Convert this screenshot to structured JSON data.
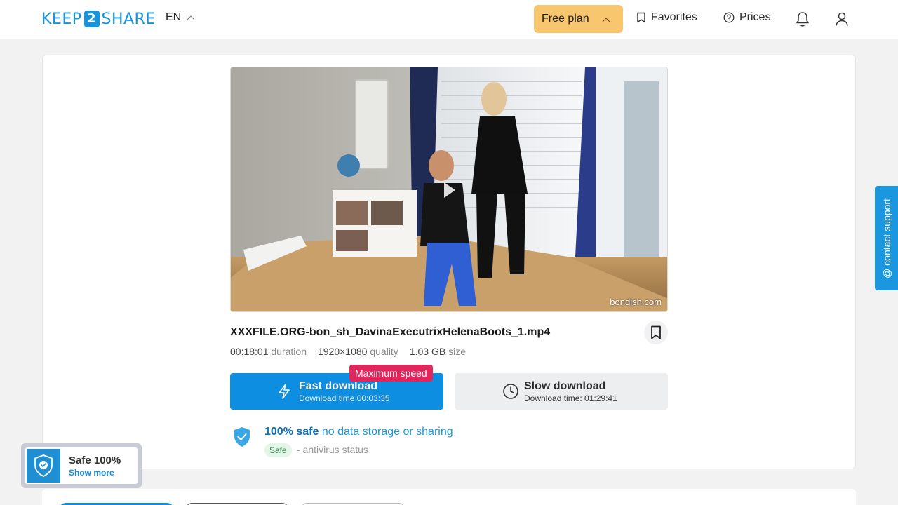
{
  "header": {
    "logo_pre": "KEEP",
    "logo_num": "2",
    "logo_post": "SHARE",
    "language": "EN",
    "plan_label": "Free plan",
    "favorites_label": "Favorites",
    "prices_label": "Prices"
  },
  "file": {
    "watermark": "bondish.com",
    "name": "XXXFILE.ORG-bon_sh_DavinaExecutrixHelenaBoots_1.mp4",
    "duration": "00:18:01",
    "duration_label": "duration",
    "quality": "1920×1080",
    "quality_label": "quality",
    "size": "1.03 GB",
    "size_label": "size"
  },
  "download": {
    "badge": "Maximum speed",
    "fast_title": "Fast download",
    "fast_time": "Download time 00:03:35",
    "slow_title": "Slow download",
    "slow_time": "Download time: 01:29:41"
  },
  "safety": {
    "bold": "100% safe",
    "rest": "no data storage or sharing",
    "pill": "Safe",
    "status": "- antivirus status"
  },
  "widget": {
    "title": "Safe 100%",
    "link": "Show more"
  },
  "support": {
    "label": "@ contact support"
  },
  "colors": {
    "accent": "#0d8ee0",
    "plan": "#f8c66e",
    "badge": "#e0265c"
  }
}
